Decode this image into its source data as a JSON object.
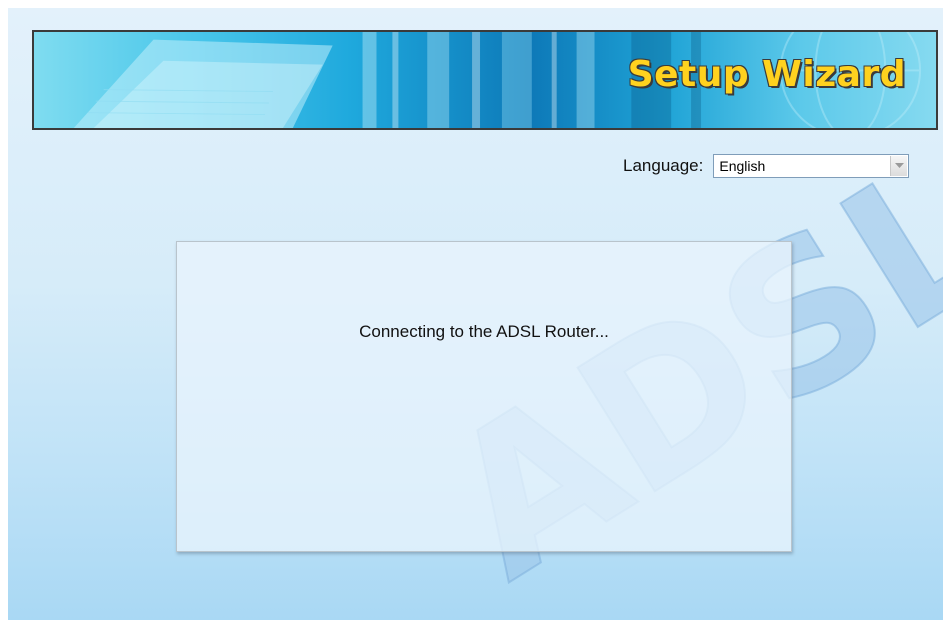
{
  "header": {
    "title": "Setup Wizard"
  },
  "language": {
    "label": "Language:",
    "selected": "English"
  },
  "status": {
    "message": "Connecting to the ADSL Router..."
  },
  "watermark": {
    "text": "ADSL"
  },
  "colors": {
    "title": "#ffd21f",
    "background": "#d6ecf9",
    "banner": "#1fa9dd"
  },
  "icons": {
    "select_arrow": "chevron-down-icon"
  }
}
